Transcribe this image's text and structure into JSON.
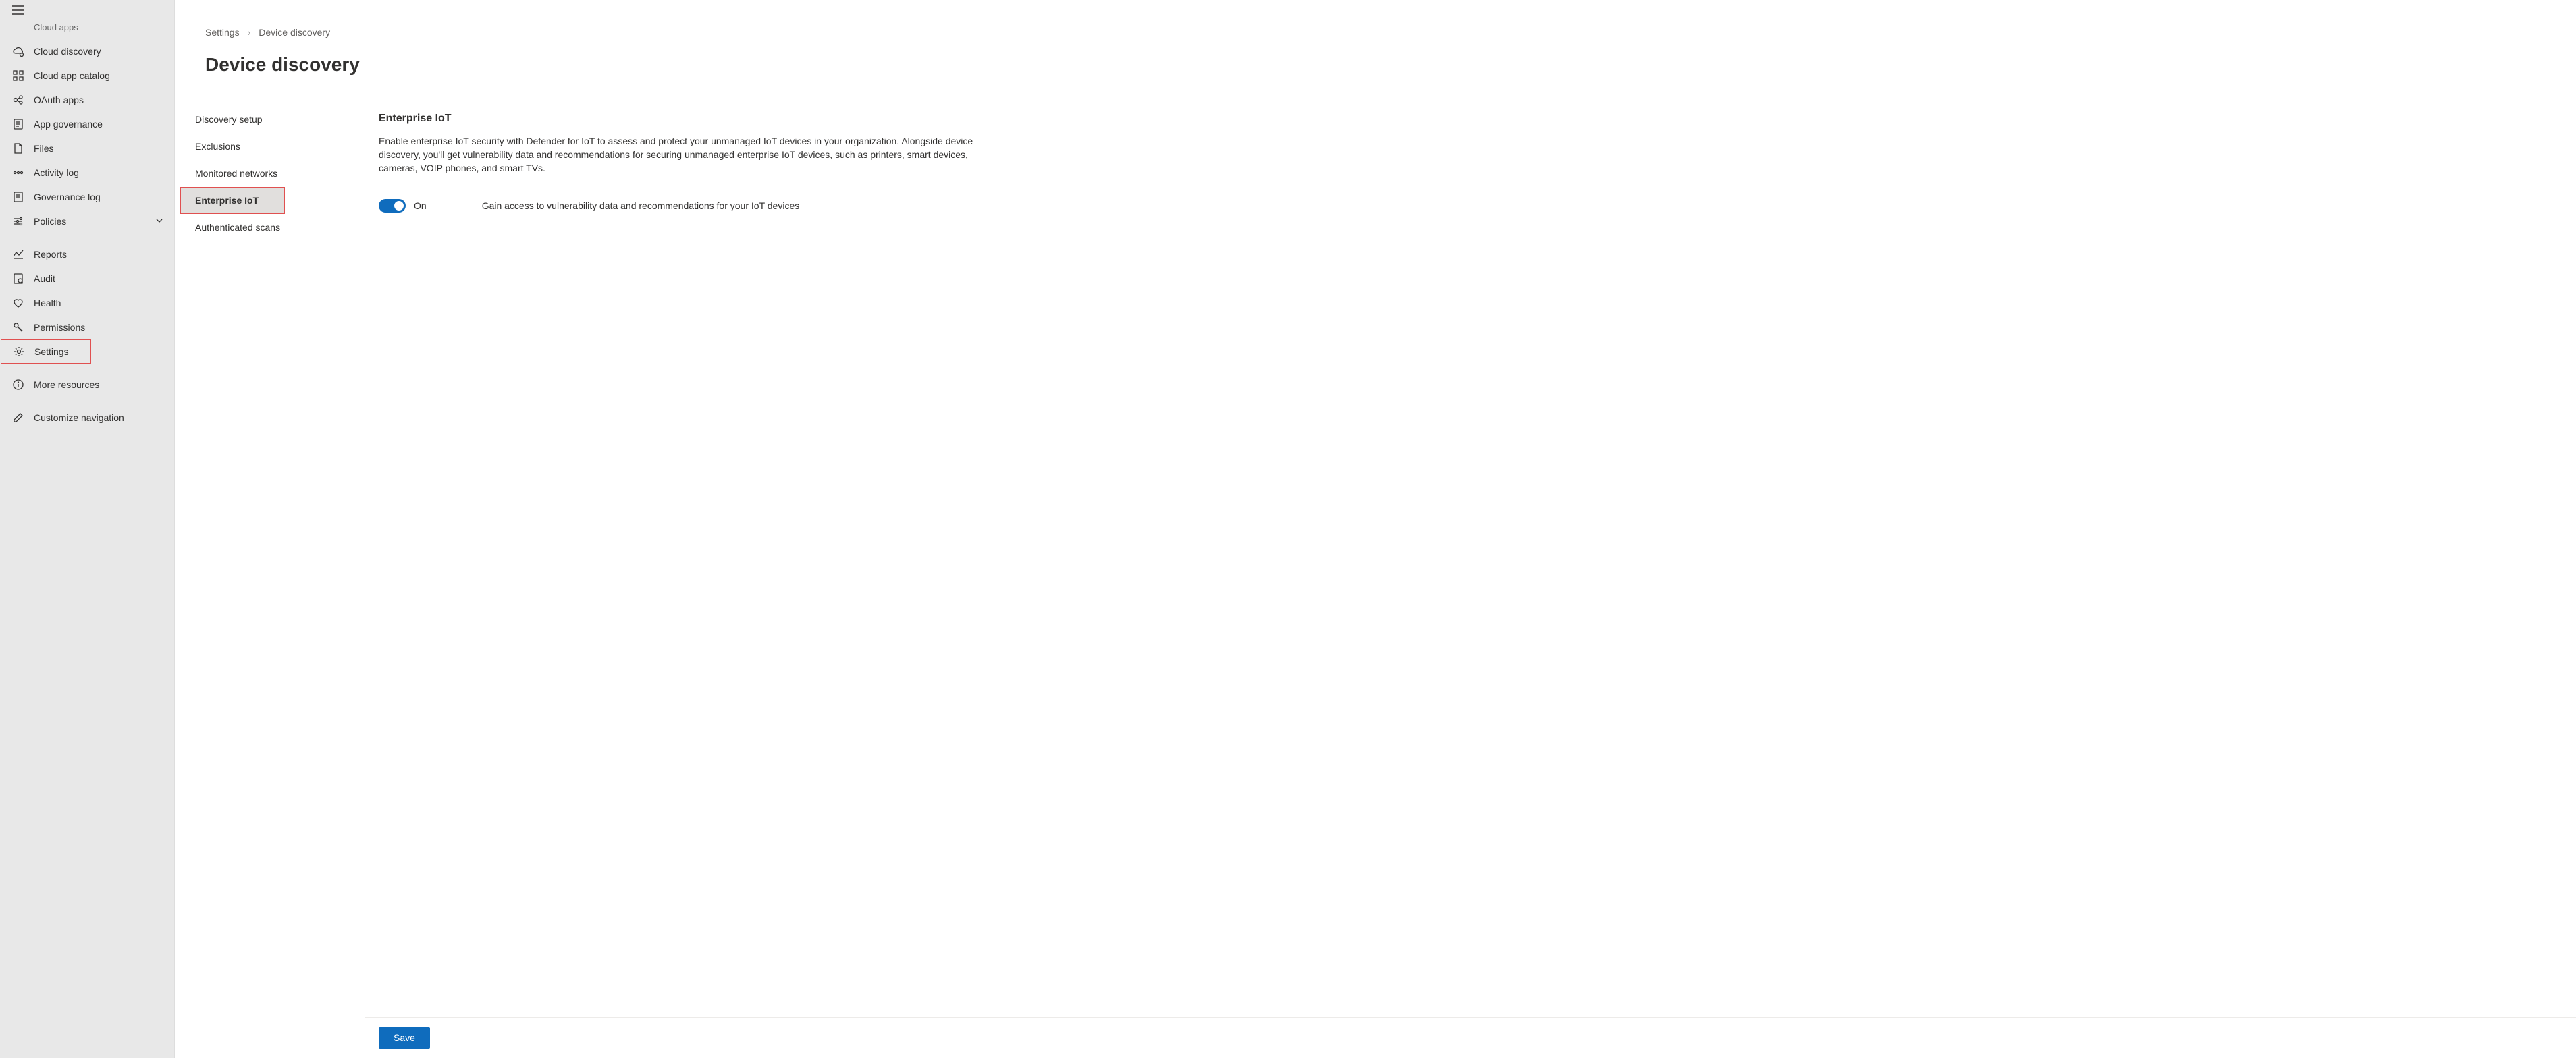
{
  "sidebar": {
    "truncated_top": "Cloud apps",
    "items_top": [
      {
        "icon": "cloud-discovery-icon",
        "label": "Cloud discovery"
      },
      {
        "icon": "catalog-icon",
        "label": "Cloud app catalog"
      },
      {
        "icon": "oauth-icon",
        "label": "OAuth apps"
      },
      {
        "icon": "governance-icon",
        "label": "App governance"
      },
      {
        "icon": "files-icon",
        "label": "Files"
      },
      {
        "icon": "activity-icon",
        "label": "Activity log"
      },
      {
        "icon": "governance-log-icon",
        "label": "Governance log"
      },
      {
        "icon": "policies-icon",
        "label": "Policies",
        "expandable": true
      }
    ],
    "items_mid": [
      {
        "icon": "reports-icon",
        "label": "Reports"
      },
      {
        "icon": "audit-icon",
        "label": "Audit"
      },
      {
        "icon": "health-icon",
        "label": "Health"
      },
      {
        "icon": "permissions-icon",
        "label": "Permissions"
      },
      {
        "icon": "settings-icon",
        "label": "Settings",
        "highlighted": true
      }
    ],
    "items_bottom": [
      {
        "icon": "info-icon",
        "label": "More resources"
      }
    ],
    "items_footer": [
      {
        "icon": "edit-icon",
        "label": "Customize navigation"
      }
    ]
  },
  "breadcrumb": {
    "item1": "Settings",
    "item2": "Device discovery"
  },
  "page_title": "Device discovery",
  "subnav": {
    "items": [
      {
        "label": "Discovery setup"
      },
      {
        "label": "Exclusions"
      },
      {
        "label": "Monitored networks"
      },
      {
        "label": "Enterprise IoT",
        "active": true,
        "highlighted": true
      },
      {
        "label": "Authenticated scans"
      }
    ]
  },
  "panel": {
    "title": "Enterprise IoT",
    "description": "Enable enterprise IoT security with Defender for IoT to assess and protect your unmanaged IoT devices in your organization. Alongside device discovery, you'll get vulnerability data and recommendations for securing unmanaged enterprise IoT devices, such as printers, smart devices, cameras, VOIP phones, and smart TVs.",
    "toggle_label": "On",
    "toggle_hint": "Gain access to vulnerability data and recommendations for your IoT devices",
    "save_label": "Save"
  }
}
